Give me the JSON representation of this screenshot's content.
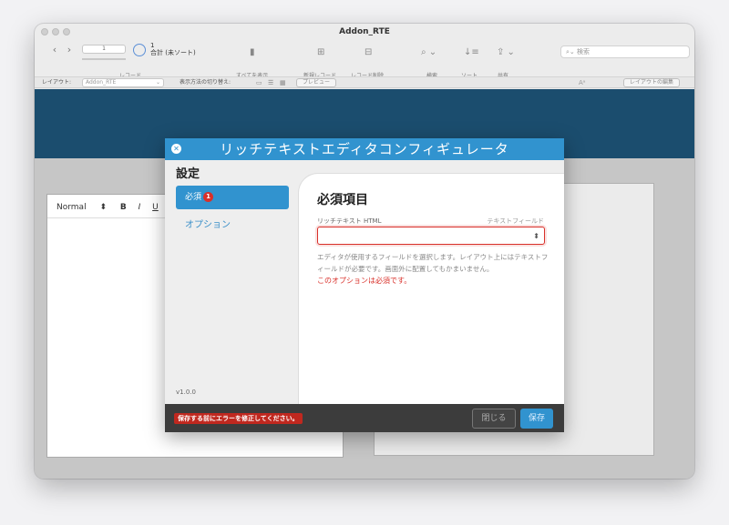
{
  "window": {
    "title": "Addon_RTE"
  },
  "toolbar": {
    "record_value": "1",
    "record_count": "1",
    "record_total": "合計 (未ソート)",
    "labels": {
      "records": "レコード",
      "show_all": "すべてを表示",
      "new_record": "新規レコード",
      "delete_record": "レコード削除",
      "find": "検索",
      "sort": "ソート",
      "share": "共有"
    },
    "search_placeholder": "検索"
  },
  "layoutbar": {
    "layout_label": "レイアウト:",
    "layout_value": "Addon_RTE",
    "view_as_label": "表示方法の切り替え:",
    "preview_label": "プレビュー",
    "edit_layout_label": "レイアウトの編集"
  },
  "editor": {
    "style_label": "Normal",
    "bold": "B",
    "italic": "I",
    "underline": "U"
  },
  "dialog": {
    "title": "リッチテキストエディタコンフィギュレータ",
    "settings_heading": "設定",
    "nav": {
      "required_label": "必須",
      "required_badge": "1",
      "options_label": "オプション"
    },
    "version": "v1.0.0",
    "panel": {
      "title": "必須項目",
      "field_label": "リッチテキスト HTML",
      "field_type": "テキストフィールド",
      "help_text": "エディタが使用するフィールドを選択します。レイアウト上にはテキストフィールドが必要です。画面外に配置してもかまいません。",
      "error_text": "このオプションは必須です。"
    },
    "footer": {
      "error_text": "保存する前にエラーを修正してください。",
      "close_label": "閉じる",
      "save_label": "保存"
    }
  },
  "colors": {
    "accent": "#3193cf",
    "banner": "#1b4d6e",
    "error": "#d9302a"
  }
}
